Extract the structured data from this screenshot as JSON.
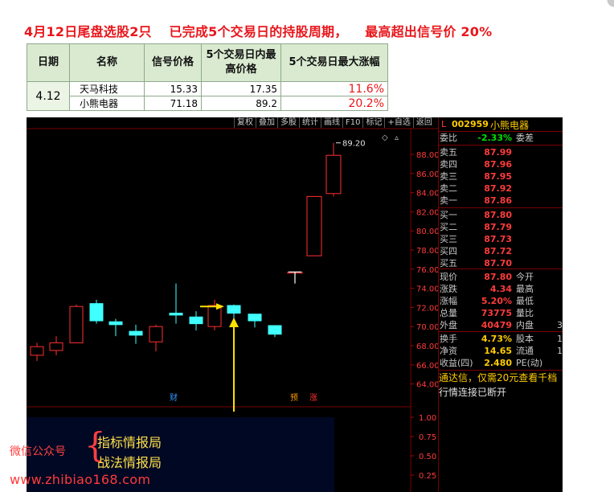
{
  "headline": {
    "part1": "4月12日尾盘选股2只",
    "part2": "已完成5个交易日的持股周期，",
    "part3": "最高超出信号价 20%"
  },
  "table": {
    "headers": [
      "日期",
      "名称",
      "信号价格",
      "5个交易日内最高价格",
      "5个交易日最大涨幅"
    ],
    "date": "4.12",
    "rows": [
      {
        "name": "天马科技",
        "signal": "15.33",
        "high": "17.35",
        "gain": "11.6%"
      },
      {
        "name": "小熊电器",
        "signal": "71.18",
        "high": "89.2",
        "gain": "20.2%"
      }
    ]
  },
  "toolbar": [
    "复权",
    "叠加",
    "多股",
    "统计",
    "画线",
    "F10",
    "标记",
    "+自选",
    "返回"
  ],
  "chart": {
    "price_labels": [
      "88.00",
      "86.00",
      "84.00",
      "82.00",
      "80.00",
      "78.00",
      "76.00",
      "74.00",
      "72.00",
      "70.00",
      "68.00",
      "66.00",
      "64.00"
    ],
    "vol_labels": [
      "1.00",
      "0.75",
      "0.50",
      "0.25"
    ],
    "peak_label": "89.20",
    "marker_cai": "财",
    "marker_yu": "预",
    "marker_zhang": "涨",
    "diamond": "◇",
    "up_arrow_glyph": "▵"
  },
  "chart_data": {
    "type": "candlestick",
    "y_axis_ticks": [
      64,
      66,
      68,
      70,
      72,
      74,
      76,
      78,
      80,
      82,
      84,
      86,
      88
    ],
    "candles": [
      {
        "open": 67.0,
        "close": 67.9,
        "high": 68.3,
        "low": 66.4
      },
      {
        "open": 67.5,
        "close": 68.3,
        "high": 69.0,
        "low": 67.0
      },
      {
        "open": 68.3,
        "close": 72.1,
        "high": 72.3,
        "low": 68.3
      },
      {
        "open": 72.4,
        "close": 70.6,
        "high": 72.8,
        "low": 70.3
      },
      {
        "open": 70.5,
        "close": 70.2,
        "high": 70.8,
        "low": 69.0
      },
      {
        "open": 69.5,
        "close": 69.1,
        "high": 70.2,
        "low": 68.2
      },
      {
        "open": 68.4,
        "close": 70.0,
        "high": 70.2,
        "low": 67.4
      },
      {
        "open": 71.4,
        "close": 71.2,
        "high": 74.5,
        "low": 70.3
      },
      {
        "open": 71.0,
        "close": 70.3,
        "high": 71.6,
        "low": 69.6
      },
      {
        "open": 70.0,
        "close": 72.2,
        "high": 72.8,
        "low": 69.6
      },
      {
        "open": 72.2,
        "close": 71.4,
        "high": 72.3,
        "low": 70.8
      },
      {
        "open": 71.3,
        "close": 70.6,
        "high": 71.3,
        "low": 69.9
      },
      {
        "open": 70.1,
        "close": 69.2,
        "high": 70.1,
        "low": 68.9
      },
      {
        "open": 75.7,
        "close": 75.7,
        "high": 75.7,
        "low": 74.5
      },
      {
        "open": 77.4,
        "close": 83.6,
        "high": 83.6,
        "low": 77.4
      },
      {
        "open": 83.9,
        "close": 87.9,
        "high": 89.2,
        "low": 83.6
      }
    ]
  },
  "quote": {
    "code": "002959",
    "name": "小熊电器",
    "ratio": {
      "label": "委比",
      "value": "-2.33%",
      "label2": "委差"
    },
    "asks": [
      {
        "label": "卖五",
        "price": "87.99"
      },
      {
        "label": "卖四",
        "price": "87.96"
      },
      {
        "label": "卖三",
        "price": "87.95"
      },
      {
        "label": "卖二",
        "price": "87.92"
      },
      {
        "label": "卖一",
        "price": "87.86"
      }
    ],
    "bids": [
      {
        "label": "买一",
        "price": "87.80"
      },
      {
        "label": "买二",
        "price": "87.79"
      },
      {
        "label": "买三",
        "price": "87.73"
      },
      {
        "label": "买四",
        "price": "87.72"
      },
      {
        "label": "买五",
        "price": "87.70"
      }
    ],
    "stats": [
      {
        "label": "现价",
        "value": "87.80",
        "label2": "今开",
        "value2": ""
      },
      {
        "label": "涨跌",
        "value": "4.34",
        "label2": "最高",
        "value2": ""
      },
      {
        "label": "涨幅",
        "value": "5.20%",
        "label2": "最低",
        "value2": ""
      },
      {
        "label": "总量",
        "value": "73775",
        "label2": "量比",
        "value2": ""
      },
      {
        "label": "外盘",
        "value": "40479",
        "label2": "内盘",
        "value2": "3"
      }
    ],
    "stats2": [
      {
        "label": "换手",
        "value": "4.73%",
        "label2": "股本",
        "value2": "1"
      },
      {
        "label": "净资",
        "value": "14.65",
        "label2": "流通",
        "value2": "1"
      },
      {
        "label": "收益(四)",
        "value": "2.480",
        "label2": "PE(动)",
        "value2": ""
      }
    ],
    "news": "通达信，仅需20元查看千档",
    "status": "行情连接已断开"
  },
  "watermark": {
    "label": "微信公众号",
    "line1": "指标情报局",
    "line2": "战法情报局",
    "url": "www.zhibiao168.com"
  }
}
